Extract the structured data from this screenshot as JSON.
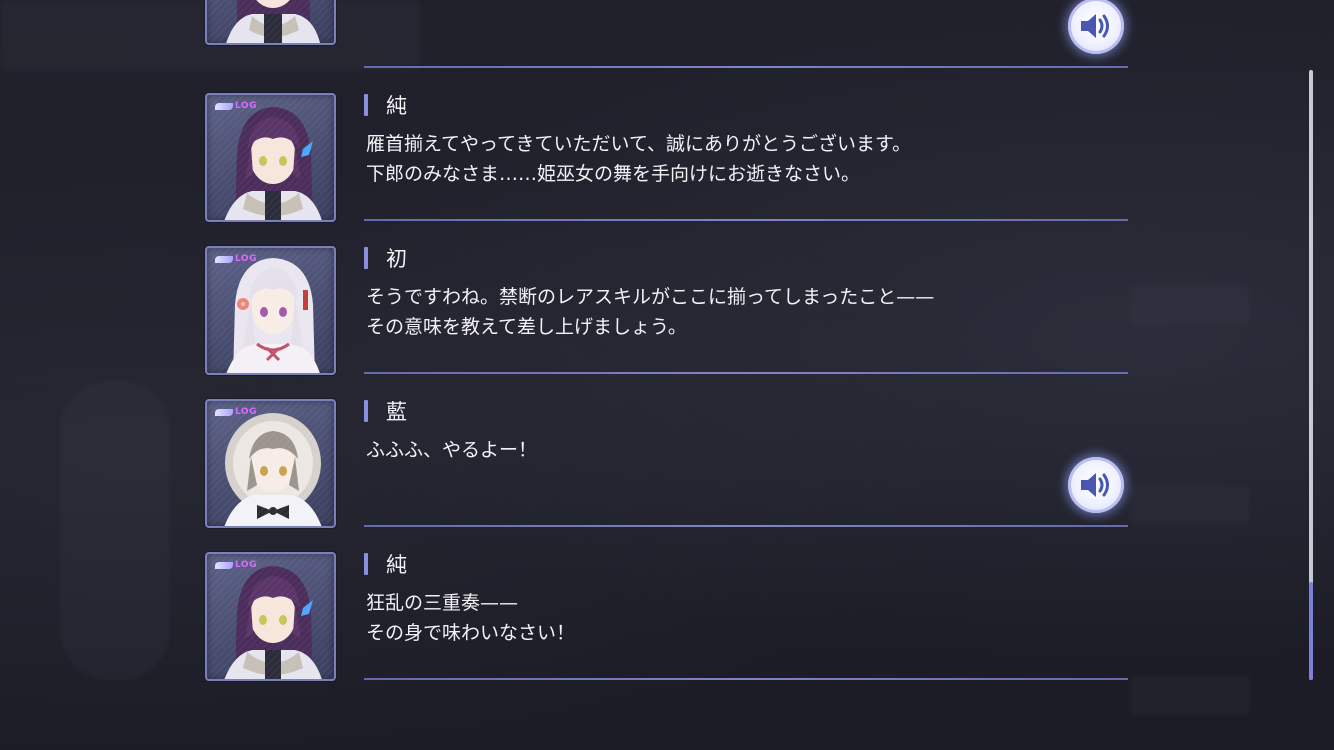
{
  "log_label": "LOG",
  "entries": [
    {
      "speaker": "",
      "lines": [],
      "voice": true,
      "character": "jun"
    },
    {
      "speaker": "純",
      "lines": [
        "雁首揃えてやってきていただいて、誠にありがとうございます。",
        "下郎のみなさま……姫巫女の舞を手向けにお逝きなさい。"
      ],
      "voice": false,
      "character": "jun"
    },
    {
      "speaker": "初",
      "lines": [
        "そうですわね。禁断のレアスキルがここに揃ってしまったこと——",
        "その意味を教えて差し上げましょう。"
      ],
      "voice": false,
      "character": "hatsu"
    },
    {
      "speaker": "藍",
      "lines": [
        "ふふふ、やるよー！"
      ],
      "voice": true,
      "character": "ai"
    },
    {
      "speaker": "純",
      "lines": [
        "狂乱の三重奏——",
        "その身で味わいなさい！"
      ],
      "voice": false,
      "character": "jun"
    }
  ],
  "scroll": {
    "position": 0.85
  },
  "colors": {
    "accent": "#8a8fe0",
    "divider": "#7a7fc8",
    "text": "#f2f2f6",
    "log_tag": "#d96bff"
  },
  "icons": {
    "voice": "speaker-volume-icon"
  }
}
